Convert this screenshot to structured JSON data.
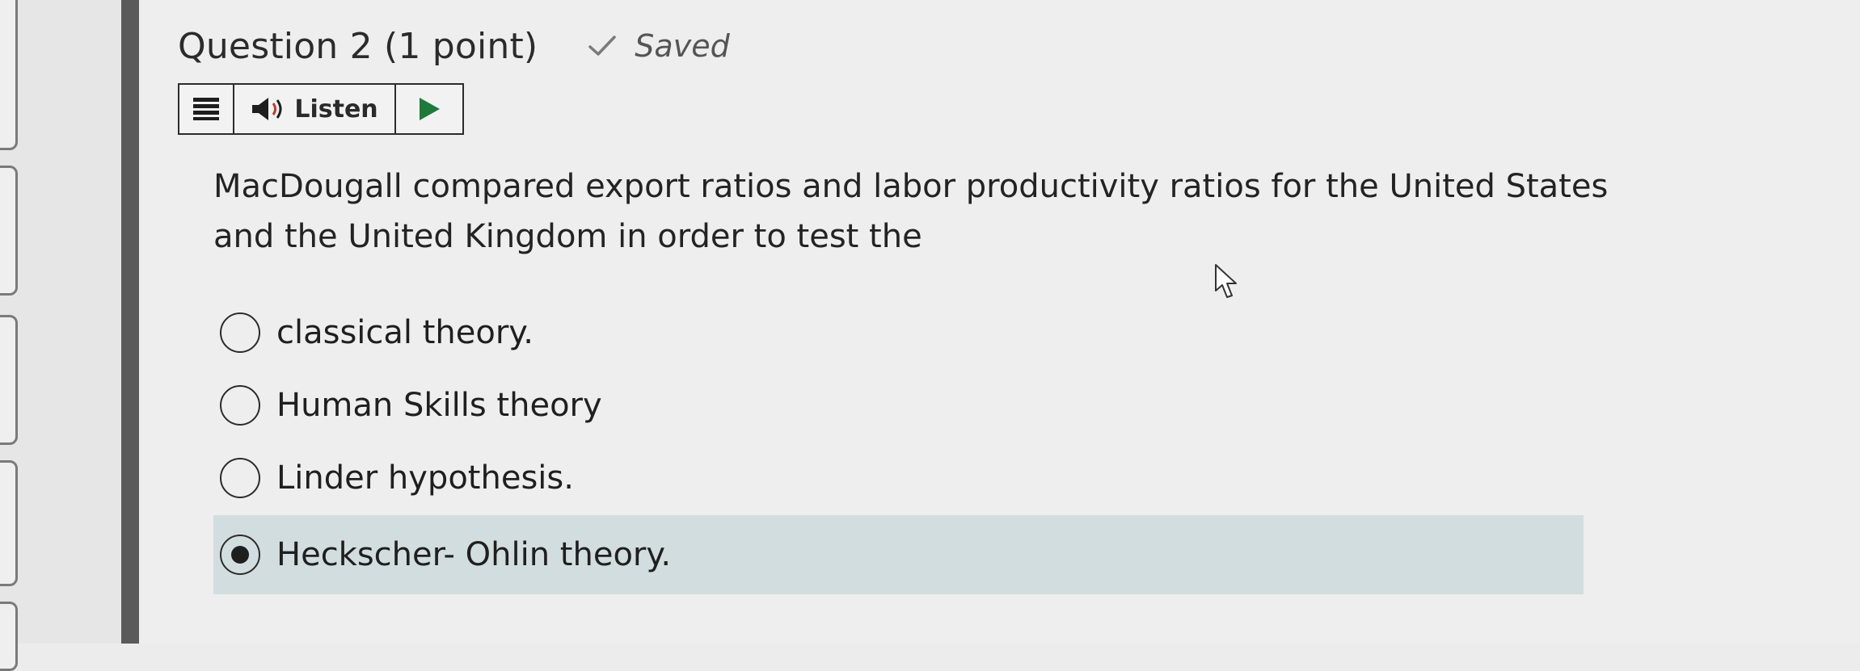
{
  "question": {
    "title": "Question 2",
    "points": "(1 point)",
    "status": "Saved",
    "status_icon": "checkmark-icon"
  },
  "toolbar": {
    "menu_icon": "hamburger-menu-icon",
    "speaker_icon": "speaker-icon",
    "listen_label": "Listen",
    "play_icon": "play-icon"
  },
  "prompt": {
    "text": "MacDougall compared export ratios and labor productivity ratios for the United States and the United Kingdom in order to test the"
  },
  "choices": [
    {
      "label": "classical theory.",
      "selected": false
    },
    {
      "label": "Human Skills theory",
      "selected": false
    },
    {
      "label": "Linder hypothesis.",
      "selected": false
    },
    {
      "label": "Heckscher- Ohlin theory.",
      "selected": true
    }
  ],
  "colors": {
    "selected_row": "#d2dde0",
    "divider": "#5a5a5a",
    "background": "#eeeeee"
  }
}
